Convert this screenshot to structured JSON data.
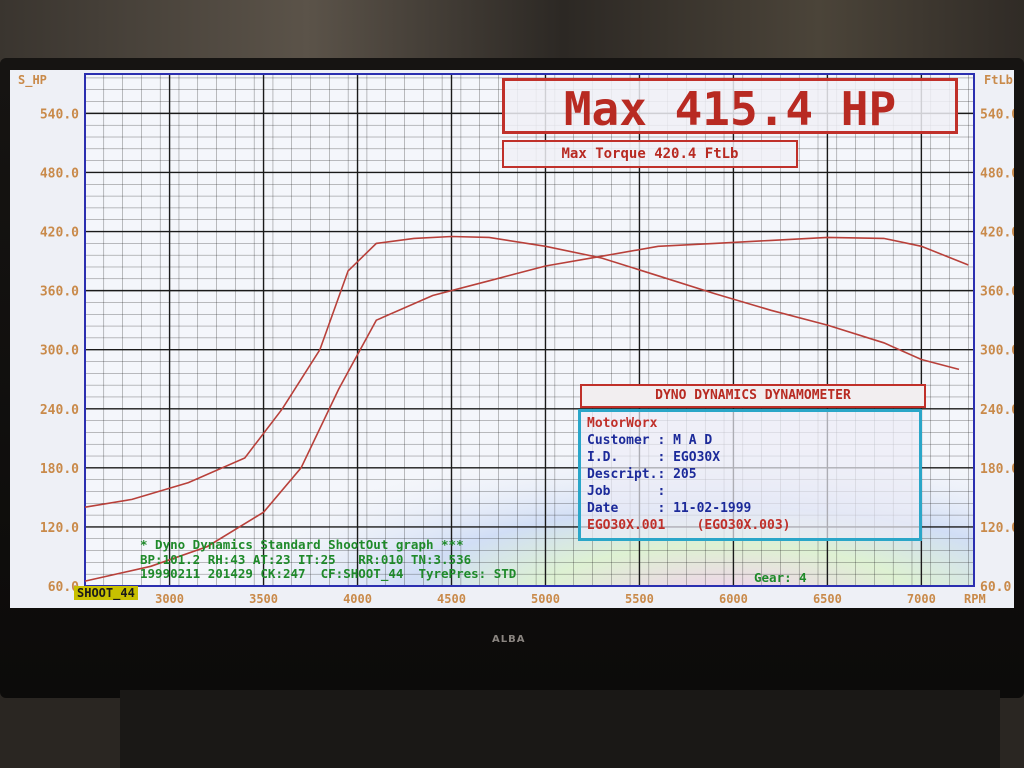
{
  "monitor": {
    "brand": "ALBA"
  },
  "header": {
    "max_hp": "Max 415.4 HP",
    "max_torque": "Max Torque 420.4 FtLb"
  },
  "info_panel": {
    "title": "DYNO DYNAMICS DYNAMOMETER",
    "shop": "MotorWorx",
    "rows": [
      {
        "label": "Customer :",
        "value": "M A D"
      },
      {
        "label": "I.D.     :",
        "value": "EGO30X"
      },
      {
        "label": "Descript.:",
        "value": "205"
      },
      {
        "label": "Job      :",
        "value": ""
      },
      {
        "label": "Date     :",
        "value": "11-02-1999"
      }
    ],
    "file_line": "EGO30X.001    (EGO30X.003)"
  },
  "footer": {
    "line1": "* Dyno Dynamics Standard ShootOut graph ***",
    "line2": "BP:101.2 RH:43 AT:23 IT:25   RR:010 TN:3.536",
    "line3": "19990211 201429 CK:247  CF:SHOOT_44  TyrePres: STD",
    "gear": "Gear: 4",
    "run_tag": "SHOOT_44"
  },
  "colors": {
    "grid": "#1a1a1a",
    "axis": "#2b2fb0",
    "curve": "#b8403a",
    "label": "#c98a4a",
    "footer_text": "#1f8a2a",
    "title_red": "#b82a22"
  },
  "chart_data": {
    "type": "line",
    "xlabel": "RPM",
    "ylabel_left": "S_HP",
    "ylabel_right": "FtLb",
    "x_ticks": [
      3000,
      3500,
      4000,
      4500,
      5000,
      5500,
      6000,
      6500,
      7000
    ],
    "y_ticks": [
      60.0,
      120.0,
      180.0,
      240.0,
      300.0,
      360.0,
      420.0,
      480.0,
      540.0
    ],
    "xlim": [
      2550,
      7280
    ],
    "ylim": [
      60,
      580
    ],
    "grid": true,
    "series": [
      {
        "x": [
          2550,
          2800,
          3100,
          3400,
          3600,
          3800,
          3950,
          4100,
          4300,
          4500,
          4700,
          5000,
          5300,
          5600,
          5900,
          6200,
          6500,
          6800,
          7000,
          7200
        ],
        "y": [
          140,
          148,
          165,
          190,
          240,
          300,
          380,
          408,
          413,
          415,
          414,
          405,
          393,
          375,
          357,
          340,
          325,
          307,
          290,
          280
        ]
      },
      {
        "x": [
          2550,
          2900,
          3200,
          3500,
          3700,
          3900,
          4100,
          4400,
          4700,
          5000,
          5300,
          5600,
          5900,
          6200,
          6500,
          6800,
          7000,
          7250
        ],
        "y": [
          65,
          80,
          100,
          135,
          180,
          260,
          330,
          355,
          370,
          385,
          395,
          405,
          408,
          411,
          414,
          413,
          405,
          386
        ]
      }
    ]
  }
}
